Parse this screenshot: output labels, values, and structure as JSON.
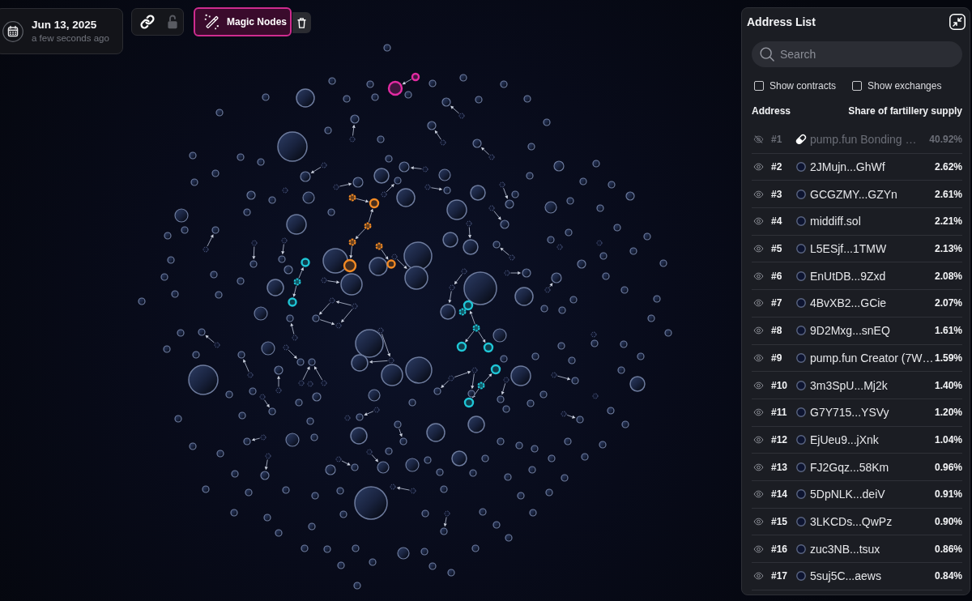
{
  "toolbar": {
    "date": "Jun 13, 2025",
    "age": "a few seconds ago",
    "locked": false,
    "magic_nodes": {
      "label": "Magic Nodes",
      "active": true
    }
  },
  "graph": {
    "clusters": [
      {
        "color": "#f28a24"
      },
      {
        "color": "#1fc6d6"
      },
      {
        "color": "#e22ba2"
      }
    ]
  },
  "address_list": {
    "title": "Address List",
    "search": {
      "placeholder": "Search"
    },
    "filters": [
      {
        "label": "Show contracts",
        "checked": false
      },
      {
        "label": "Show exchanges",
        "checked": false
      }
    ],
    "columns": [
      "Address",
      "Share of fartillery supply"
    ],
    "rows": [
      {
        "rank": "#1",
        "address": "pump.fun Bonding …",
        "share": "40.92%",
        "kind": "contract",
        "hidden": true
      },
      {
        "rank": "#2",
        "address": "2JMujn...GhWf",
        "share": "2.62%",
        "kind": "wallet",
        "hidden": false
      },
      {
        "rank": "#3",
        "address": "GCGZMY...GZYn",
        "share": "2.61%",
        "kind": "wallet",
        "hidden": false
      },
      {
        "rank": "#4",
        "address": "middiff.sol",
        "share": "2.21%",
        "kind": "wallet",
        "hidden": false
      },
      {
        "rank": "#5",
        "address": "L5ESjf...1TMW",
        "share": "2.13%",
        "kind": "wallet",
        "hidden": false
      },
      {
        "rank": "#6",
        "address": "EnUtDB...9Zxd",
        "share": "2.08%",
        "kind": "wallet",
        "hidden": false
      },
      {
        "rank": "#7",
        "address": "4BvXB2...GCie",
        "share": "2.07%",
        "kind": "wallet",
        "hidden": false
      },
      {
        "rank": "#8",
        "address": "9D2Mxg...snEQ",
        "share": "1.61%",
        "kind": "wallet",
        "hidden": false
      },
      {
        "rank": "#9",
        "address": "pump.fun Creator (7W…",
        "share": "1.59%",
        "kind": "wallet",
        "hidden": false
      },
      {
        "rank": "#10",
        "address": "3m3SpU...Mj2k",
        "share": "1.40%",
        "kind": "wallet",
        "hidden": false
      },
      {
        "rank": "#11",
        "address": "G7Y715...YSVy",
        "share": "1.20%",
        "kind": "wallet",
        "hidden": false
      },
      {
        "rank": "#12",
        "address": "EjUeu9...jXnk",
        "share": "1.04%",
        "kind": "wallet",
        "hidden": false
      },
      {
        "rank": "#13",
        "address": "FJ2Gqz...58Km",
        "share": "0.96%",
        "kind": "wallet",
        "hidden": false
      },
      {
        "rank": "#14",
        "address": "5DpNLK...deiV",
        "share": "0.91%",
        "kind": "wallet",
        "hidden": false
      },
      {
        "rank": "#15",
        "address": "3LKCDs...QwPz",
        "share": "0.90%",
        "kind": "wallet",
        "hidden": false
      },
      {
        "rank": "#16",
        "address": "zuc3NB...tsux",
        "share": "0.86%",
        "kind": "wallet",
        "hidden": false
      },
      {
        "rank": "#17",
        "address": "5suj5C...aews",
        "share": "0.84%",
        "kind": "wallet",
        "hidden": false
      }
    ]
  }
}
